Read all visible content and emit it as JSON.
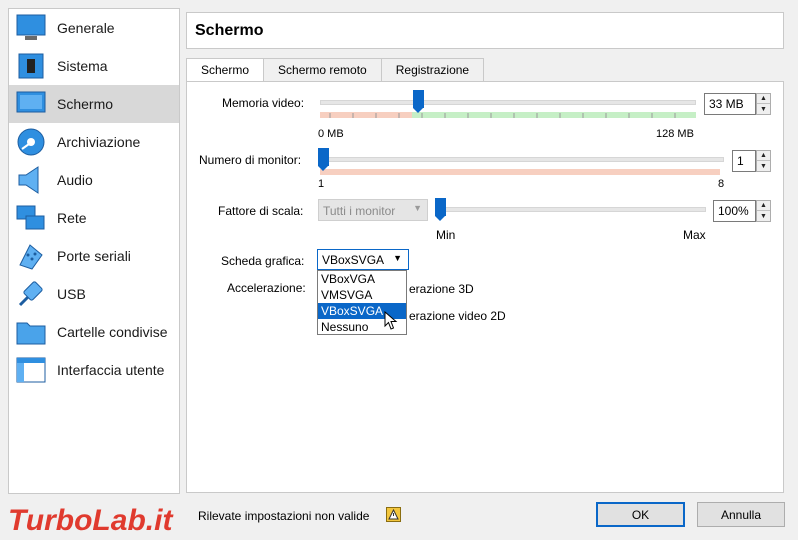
{
  "sidebar": {
    "items": [
      {
        "label": "Generale",
        "icon": "monitor-icon"
      },
      {
        "label": "Sistema",
        "icon": "chip-icon"
      },
      {
        "label": "Schermo",
        "icon": "display-icon",
        "active": true
      },
      {
        "label": "Archiviazione",
        "icon": "disk-icon"
      },
      {
        "label": "Audio",
        "icon": "speaker-icon"
      },
      {
        "label": "Rete",
        "icon": "network-icon"
      },
      {
        "label": "Porte seriali",
        "icon": "serial-port-icon"
      },
      {
        "label": "USB",
        "icon": "usb-icon"
      },
      {
        "label": "Cartelle condivise",
        "icon": "folder-icon"
      },
      {
        "label": "Interfaccia utente",
        "icon": "window-icon"
      }
    ]
  },
  "header": {
    "title": "Schermo"
  },
  "tabs": [
    {
      "label": "Schermo",
      "active": true
    },
    {
      "label": "Schermo remoto"
    },
    {
      "label": "Registrazione"
    }
  ],
  "video_memory": {
    "label": "Memoria video:",
    "value": "33 MB",
    "min_label": "0 MB",
    "max_label": "128 MB",
    "fraction": 0.26
  },
  "monitors": {
    "label": "Numero di monitor:",
    "value": "1",
    "min_label": "1",
    "max_label": "8",
    "fraction": 0.0
  },
  "scale": {
    "label": "Fattore di scala:",
    "combo_value": "Tutti i monitor",
    "value": "100%",
    "min_label": "Min",
    "max_label": "Max",
    "fraction": 0.0
  },
  "graphics": {
    "label": "Scheda grafica:",
    "selected": "VBoxSVGA",
    "options": [
      "VBoxVGA",
      "VMSVGA",
      "VBoxSVGA",
      "Nessuno"
    ],
    "highlighted_index": 2
  },
  "acceleration": {
    "label": "Accelerazione:",
    "option_3d": "erazione 3D",
    "option_2d": "erazione video 2D"
  },
  "footer": {
    "warning_text": "Rilevate impostazioni non valide",
    "ok_label": "OK",
    "cancel_label": "Annulla",
    "watermark": "TurboLab.it"
  },
  "colors": {
    "accent": "#0a67c8",
    "band_green": "#c6efc6",
    "band_red": "#f7cfc0"
  }
}
